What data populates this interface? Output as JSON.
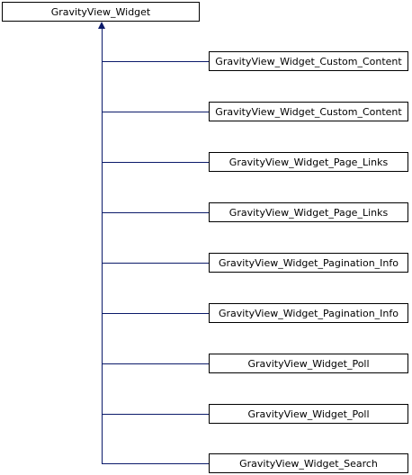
{
  "diagram": {
    "parent": {
      "label": "GravityView_Widget"
    },
    "children": [
      {
        "label": "GravityView_Widget_Custom_Content"
      },
      {
        "label": "GravityView_Widget_Custom_Content"
      },
      {
        "label": "GravityView_Widget_Page_Links"
      },
      {
        "label": "GravityView_Widget_Page_Links"
      },
      {
        "label": "GravityView_Widget_Pagination_Info"
      },
      {
        "label": "GravityView_Widget_Pagination_Info"
      },
      {
        "label": "GravityView_Widget_Poll"
      },
      {
        "label": "GravityView_Widget_Poll"
      },
      {
        "label": "GravityView_Widget_Search"
      }
    ],
    "colors": {
      "edge": "#0b1a6a",
      "border": "#000000",
      "background": "#ffffff"
    }
  }
}
